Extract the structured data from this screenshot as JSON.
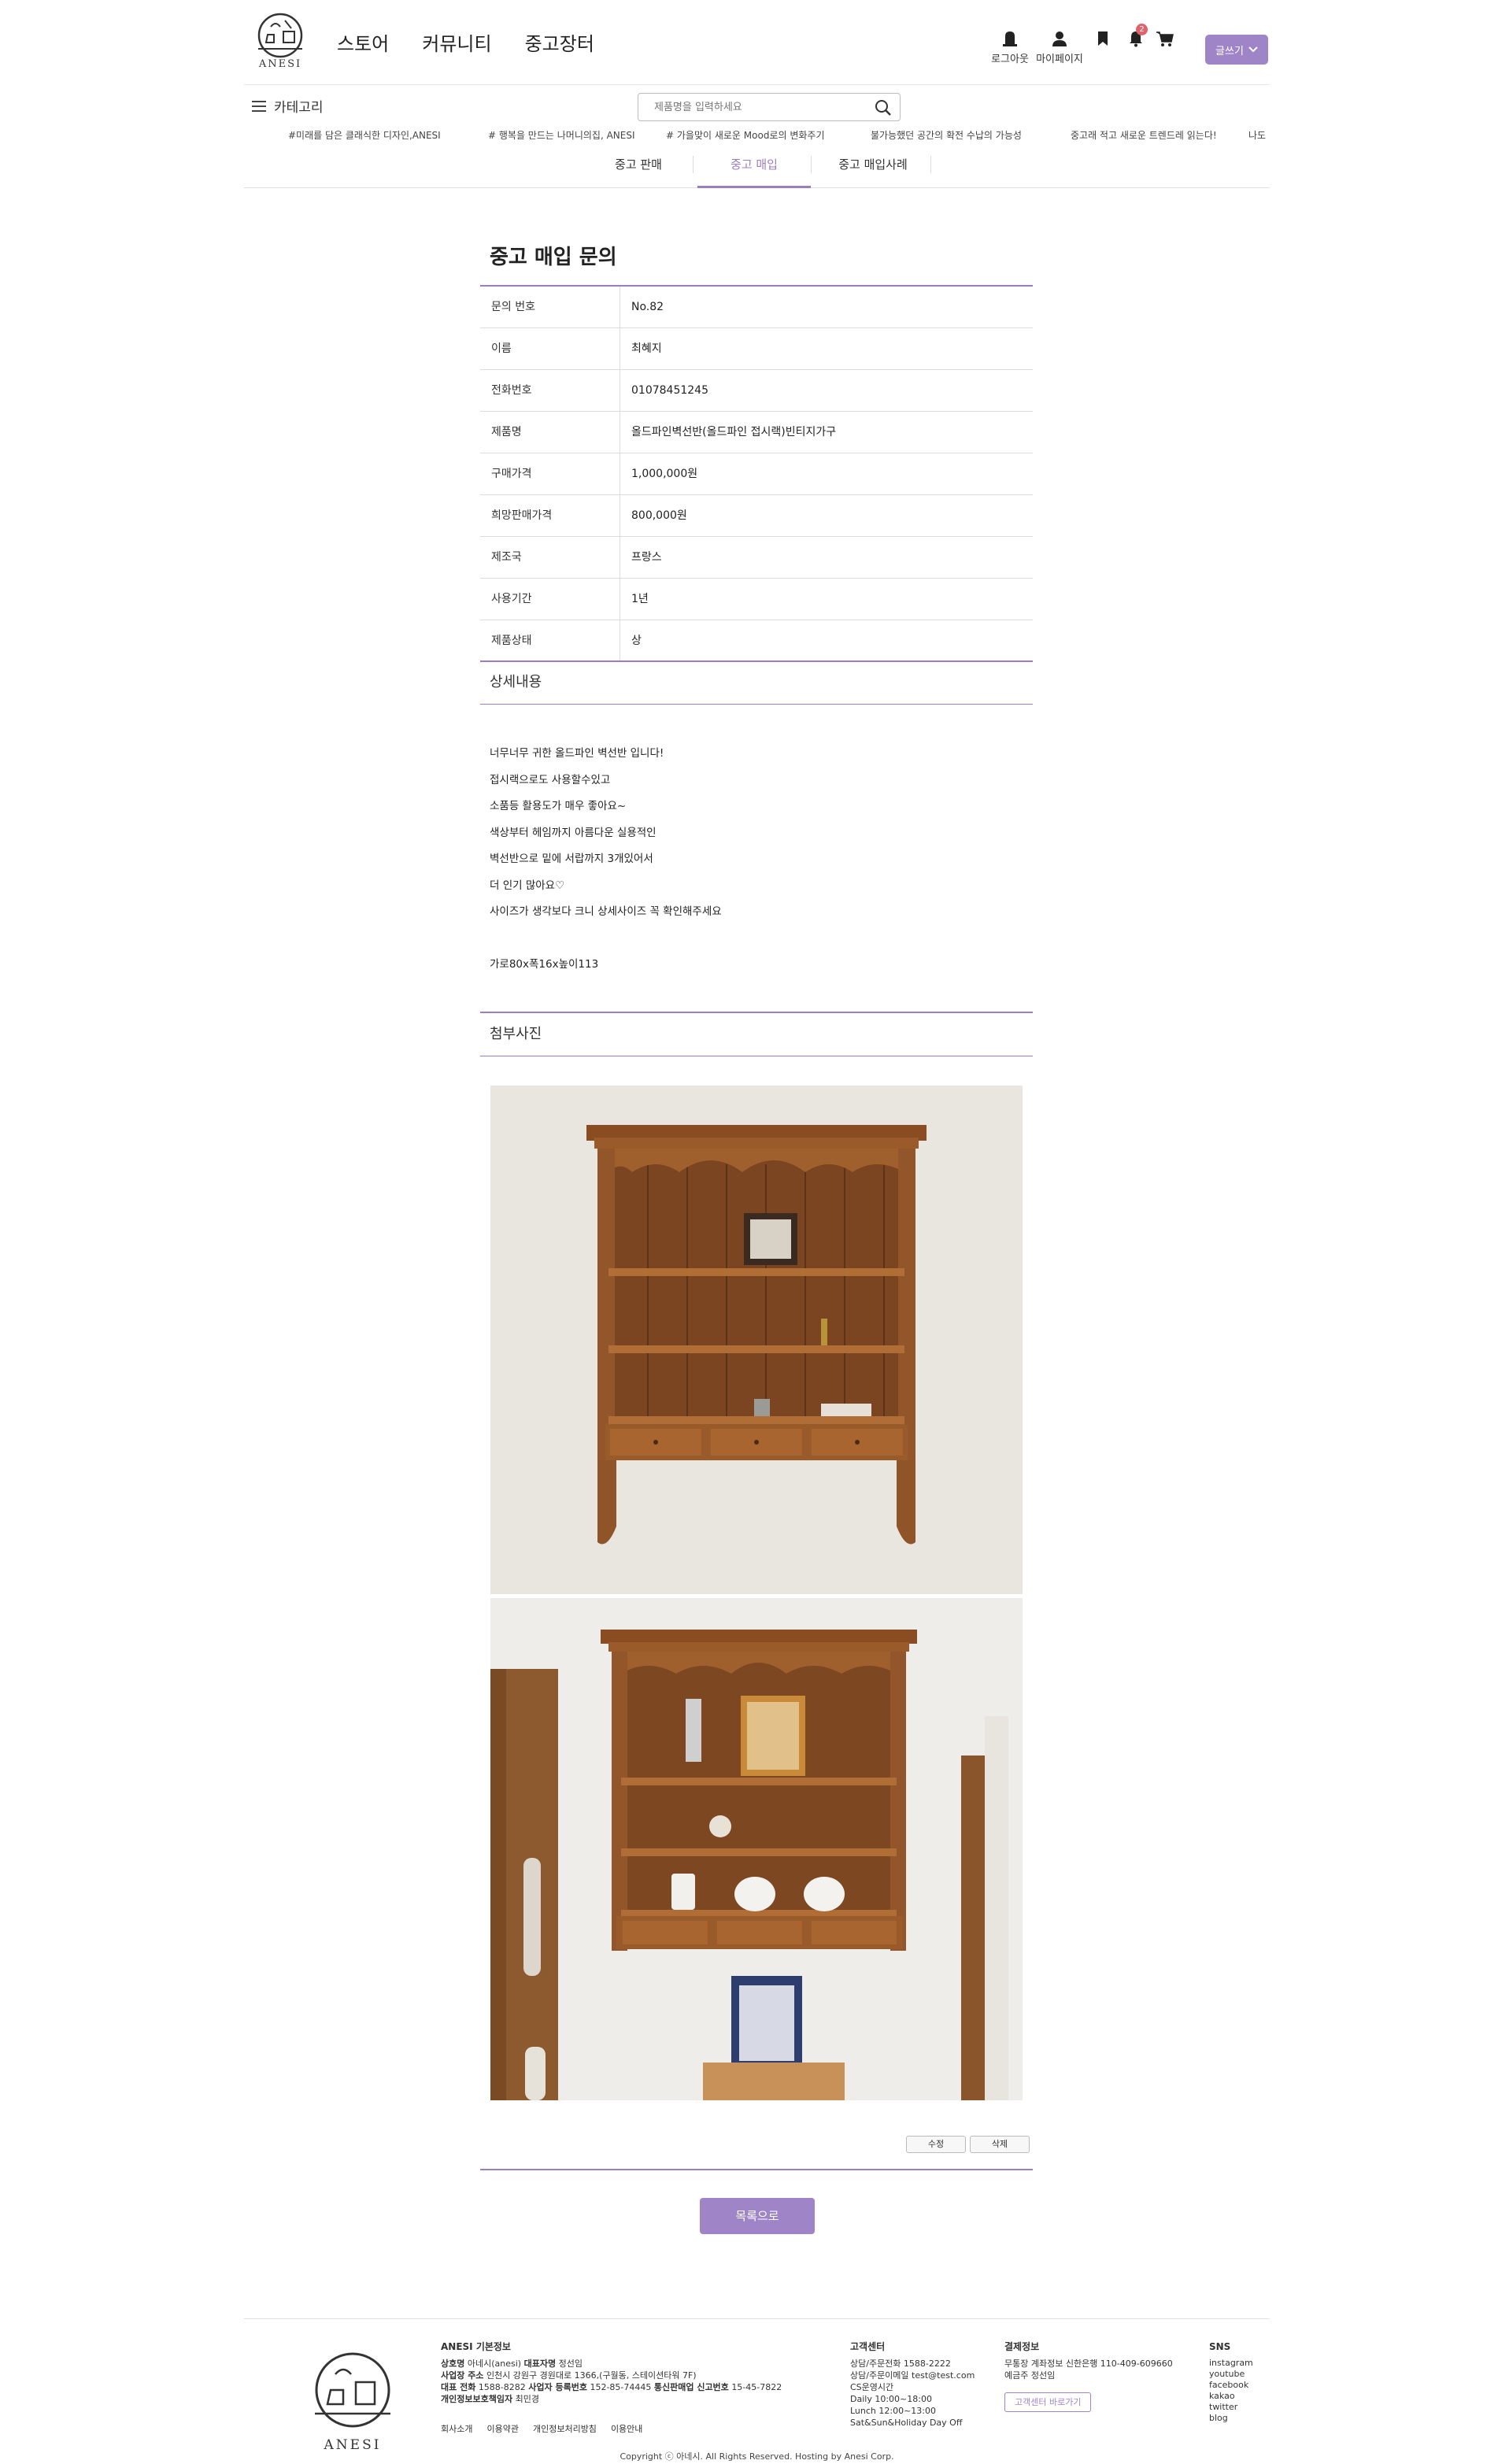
{
  "header": {
    "logo_text": "ANESI",
    "nav": [
      "스토어",
      "커뮤니티",
      "중고장터"
    ],
    "logout_label": "로그아웃",
    "mypage_label": "마이페이지",
    "notification_count": "2",
    "write_label": "글쓰기"
  },
  "subbar": {
    "category_label": "카테고리",
    "search_placeholder": "제품명을 입력하세요"
  },
  "ticker": [
    "#미래를 담은 클래식한 디자인,ANESI",
    "# 행복을 만드는 나머니의집, ANESI",
    "# 가을맞이 새로운 Mood로의 변화주기",
    "불가능했던 공간의 확전 수납의 가능성",
    "중고래 적고 새로운 트렌드레 읽는다!",
    "나도"
  ],
  "tabs": [
    "중고 판매",
    "중고 매입",
    "중고 매입사례"
  ],
  "page": {
    "title": "중고 매입 문의",
    "rows": [
      {
        "key": "문의 번호",
        "value": "No.82"
      },
      {
        "key": "이름",
        "value": "최혜지"
      },
      {
        "key": "전화번호",
        "value": "01078451245"
      },
      {
        "key": "제품명",
        "value": "올드파인벽선반(올드파인 접시랙)빈티지가구"
      },
      {
        "key": "구매가격",
        "value": "1,000,000원"
      },
      {
        "key": "희망판매가격",
        "value": "800,000원"
      },
      {
        "key": "제조국",
        "value": "프랑스"
      },
      {
        "key": "사용기간",
        "value": "1년"
      },
      {
        "key": "제품상태",
        "value": "상"
      }
    ],
    "detail_heading": "상세내용",
    "detail_lines": [
      "너무너무 귀한 올드파인 벽선반 입니다!",
      "접시랙으로도 사용할수있고",
      "소품등 활용도가 매우 좋아요~",
      "색상부터 헤임까지 아름다운 실용적인",
      "벽선반으로 밑에 서랍까지 3개있어서",
      "더 인기 많아요♡",
      "사이즈가 생각보다 크니 상세사이즈 꼭 확인해주세요"
    ],
    "size_line": "가로80x폭16x높이113",
    "photo_heading": "첨부사진",
    "edit_label": "수정",
    "delete_label": "삭제",
    "list_label": "목록으로"
  },
  "footer": {
    "logo_text": "ANESI",
    "info_title": "ANESI 기본정보",
    "info_lines": [
      {
        "b": "상호명",
        "t": "아네시(anesi)",
        "b2": "대표자명",
        "t2": "정선임"
      },
      {
        "b": "사업장 주소",
        "t": "인천시 강원구 경원대로 1366,(구월동, 스테이션타워 7F)",
        "b2": "",
        "t2": ""
      },
      {
        "b": "대표 전화",
        "t": "1588-8282",
        "b2": "사업자 등록번호",
        "t2": "152-85-74445"
      },
      {
        "b": "개인정보보호책임자",
        "t": "최민경",
        "b2": "",
        "t2": ""
      }
    ],
    "info_line3_extra_b": "통신판매업 신고번호",
    "info_line3_extra_t": "15-45-7822",
    "links": [
      "회사소개",
      "이용약관",
      "개인정보처리방침",
      "이용안내"
    ],
    "cs_title": "고객센터",
    "cs_lines": [
      "상담/주문전화 1588-2222",
      "상담/주문이메일 test@test.com",
      "CS운영시간",
      "Daily 10:00~18:00",
      "Lunch 12:00~13:00",
      "Sat&Sun&Holiday Day Off"
    ],
    "pay_title": "결제정보",
    "pay_lines": [
      "무통장 계좌정보 신한은행 110-409-609660",
      "예금주 정선임"
    ],
    "cs_button": "고객센터 바로가기",
    "sns_title": "SNS",
    "sns": [
      "instagram",
      "youtube",
      "facebook",
      "kakao",
      "twitter",
      "blog"
    ],
    "copyright": "Copyright ⓒ 아네시. All Rights Reserved. Hosting by Anesi Corp."
  },
  "colors": {
    "accent": "#a084c8",
    "badge": "#e0636b"
  },
  "icons": [
    "logout-icon",
    "mypage-icon",
    "bookmark-icon",
    "bell-icon",
    "cart-icon",
    "menu-icon",
    "search-icon",
    "chevron-down-icon"
  ]
}
